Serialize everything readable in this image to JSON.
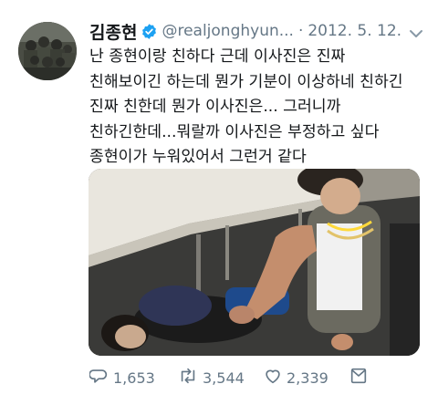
{
  "tweet": {
    "author_name": "김종현",
    "handle": "@realjonghyun...",
    "separator": "·",
    "date": "2012. 5. 12.",
    "text": "난 종현이랑 친하다 근데 이사진은 진짜\n친해보이긴 하는데 뭔가 기분이 이상하네 친하긴\n진짜 친한데 뭔가 이사진은... 그러니까\n친하긴한데...뭐랄까 이사진은 부정하고 싶다\n종현이가 누워있어서 그런거 같다"
  },
  "actions": {
    "reply_count": "1,653",
    "retweet_count": "3,544",
    "like_count": "2,339"
  },
  "colors": {
    "verified": "#1da1f2",
    "secondary_text": "#657786",
    "primary_text": "#14171a"
  },
  "icons": [
    "verified-badge-icon",
    "caret-down-icon",
    "reply-icon",
    "retweet-icon",
    "like-icon",
    "share-icon"
  ]
}
